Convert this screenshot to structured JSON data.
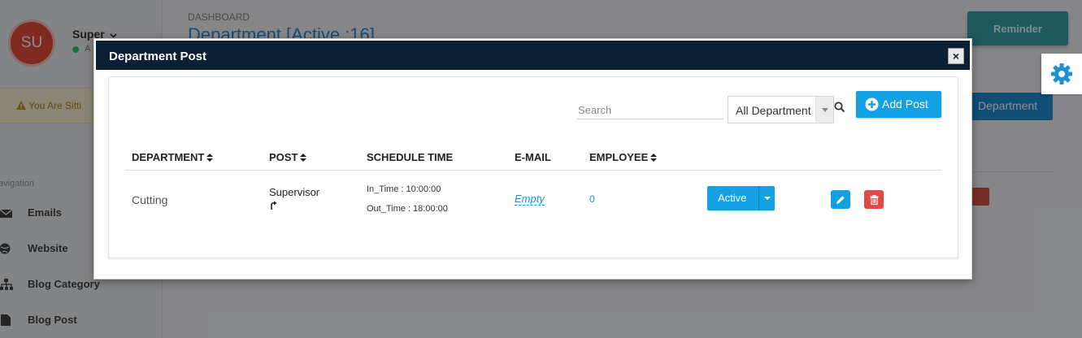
{
  "background": {
    "user": {
      "initials": "SU",
      "name": "Super",
      "status": "A"
    },
    "warning": "You Are Sitti",
    "nav": {
      "title": "avigation",
      "items": [
        {
          "label": "Emails",
          "icon": "envelope-icon"
        },
        {
          "label": "Website",
          "icon": "globe-icon"
        },
        {
          "label": "Blog Category",
          "icon": "sitemap-icon"
        },
        {
          "label": "Blog Post",
          "icon": "file-icon"
        }
      ]
    },
    "breadcrumb": "DASHBOARD",
    "page_title": "Department [Active :16]",
    "add_department_label": "Department",
    "reminder_label": "Reminder"
  },
  "modal": {
    "title": "Department Post",
    "close_label": "×",
    "search": {
      "placeholder": "Search",
      "value": ""
    },
    "department_filter": {
      "selected": "All Department"
    },
    "add_post_label": "Add Post",
    "table": {
      "headers": {
        "department": "DEPARTMENT",
        "post": "POST",
        "schedule_time": "SCHEDULE TIME",
        "email": "E-MAIL",
        "employee": "EMPLOYEE"
      },
      "rows": [
        {
          "department": "Cutting",
          "post": "Supervisor",
          "in_time": "In_Time : 10:00:00",
          "out_time": "Out_Time : 18:00:00",
          "email": "Empty",
          "employee": "0",
          "status": "Active"
        }
      ]
    }
  },
  "colors": {
    "header_bg": "#0d1f35",
    "primary": "#14a1e4",
    "danger": "#e04b45",
    "link": "#1b8fd9"
  }
}
